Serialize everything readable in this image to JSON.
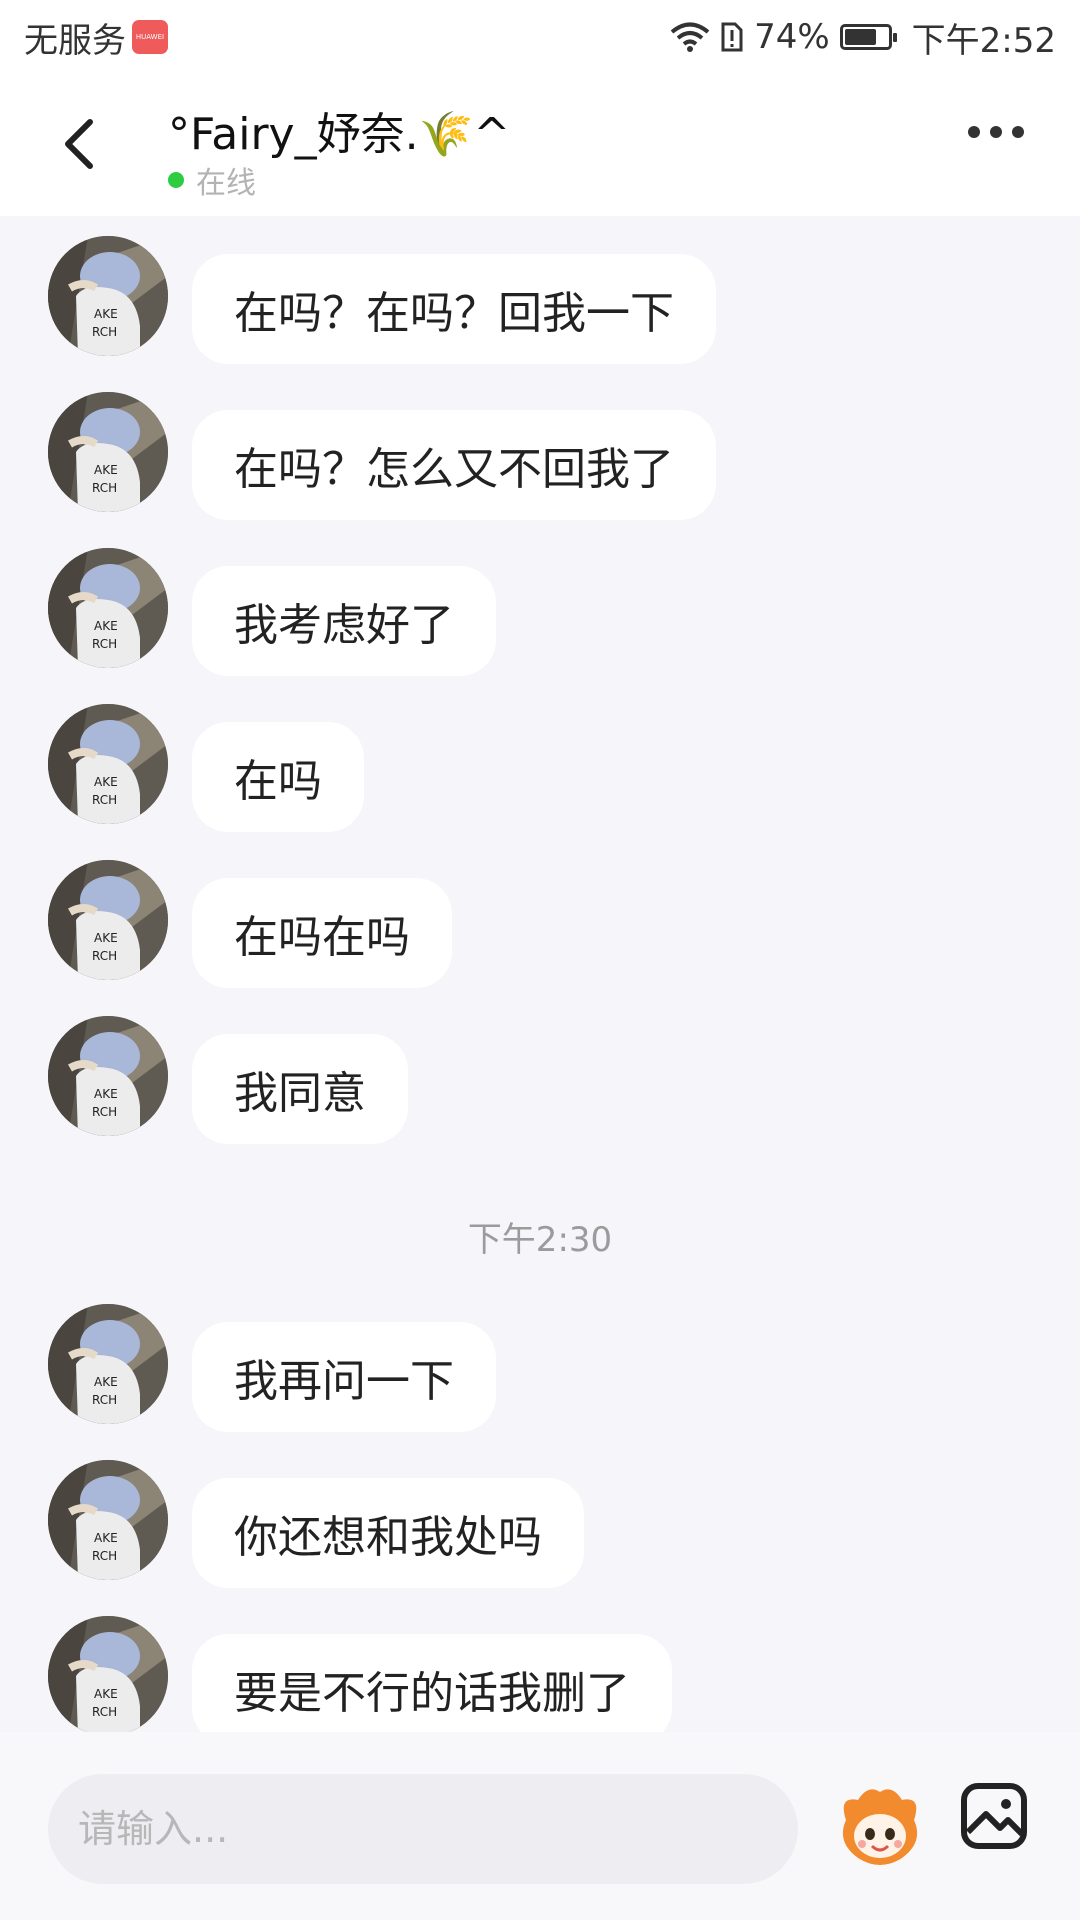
{
  "status_bar": {
    "carrier": "无服务",
    "carrier_badge": "HUAWEI",
    "battery_percent": "74%",
    "battery_level": 0.74,
    "time": "下午2:52"
  },
  "header": {
    "contact_name": "°Fairy_妤奈.🌾^",
    "presence": "在线",
    "presence_color": "#2ecc40"
  },
  "messages": [
    {
      "text": "在吗？在吗？回我一下"
    },
    {
      "text": "在吗？怎么又不回我了"
    },
    {
      "text": "我考虑好了"
    },
    {
      "text": "在吗"
    },
    {
      "text": "在吗在吗"
    },
    {
      "text": "我同意"
    },
    {
      "text": "我再问一下"
    },
    {
      "text": "你还想和我处吗"
    },
    {
      "text": "要是不行的话我删了"
    }
  ],
  "timestamp": "下午2:30",
  "input": {
    "placeholder": "请输入..."
  },
  "icons": {
    "back": "chevron-left-icon",
    "more": "more-dots-icon",
    "emoji": "mascot-emoji-icon",
    "image": "image-picture-icon"
  }
}
